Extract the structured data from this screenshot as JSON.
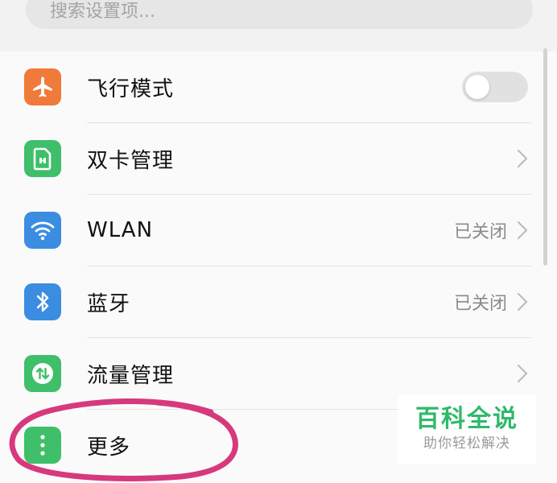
{
  "search": {
    "placeholder": "搜索设置项..."
  },
  "items": [
    {
      "label": "飞行模式",
      "icon": "airplane-icon",
      "icon_color": "#f07a3a",
      "control": "toggle",
      "toggle_on": false
    },
    {
      "label": "双卡管理",
      "icon": "sim-card-icon",
      "icon_color": "#3fbf6a",
      "control": "chevron"
    },
    {
      "label": "WLAN",
      "value": "已关闭",
      "icon": "wifi-icon",
      "icon_color": "#3a8de0",
      "control": "chevron"
    },
    {
      "label": "蓝牙",
      "value": "已关闭",
      "icon": "bluetooth-icon",
      "icon_color": "#3a8de0",
      "control": "chevron"
    },
    {
      "label": "流量管理",
      "icon": "data-usage-icon",
      "icon_color": "#3fbf6a",
      "control": "chevron"
    },
    {
      "label": "更多",
      "icon": "more-vertical-icon",
      "icon_color": "#3fbf6a",
      "control": "none"
    }
  ],
  "watermark": {
    "title": "百科全说",
    "subtitle": "助你轻松解决",
    "color": "#2fb96b"
  },
  "annotation": {
    "color": "#d63a7d",
    "target": "更多"
  }
}
